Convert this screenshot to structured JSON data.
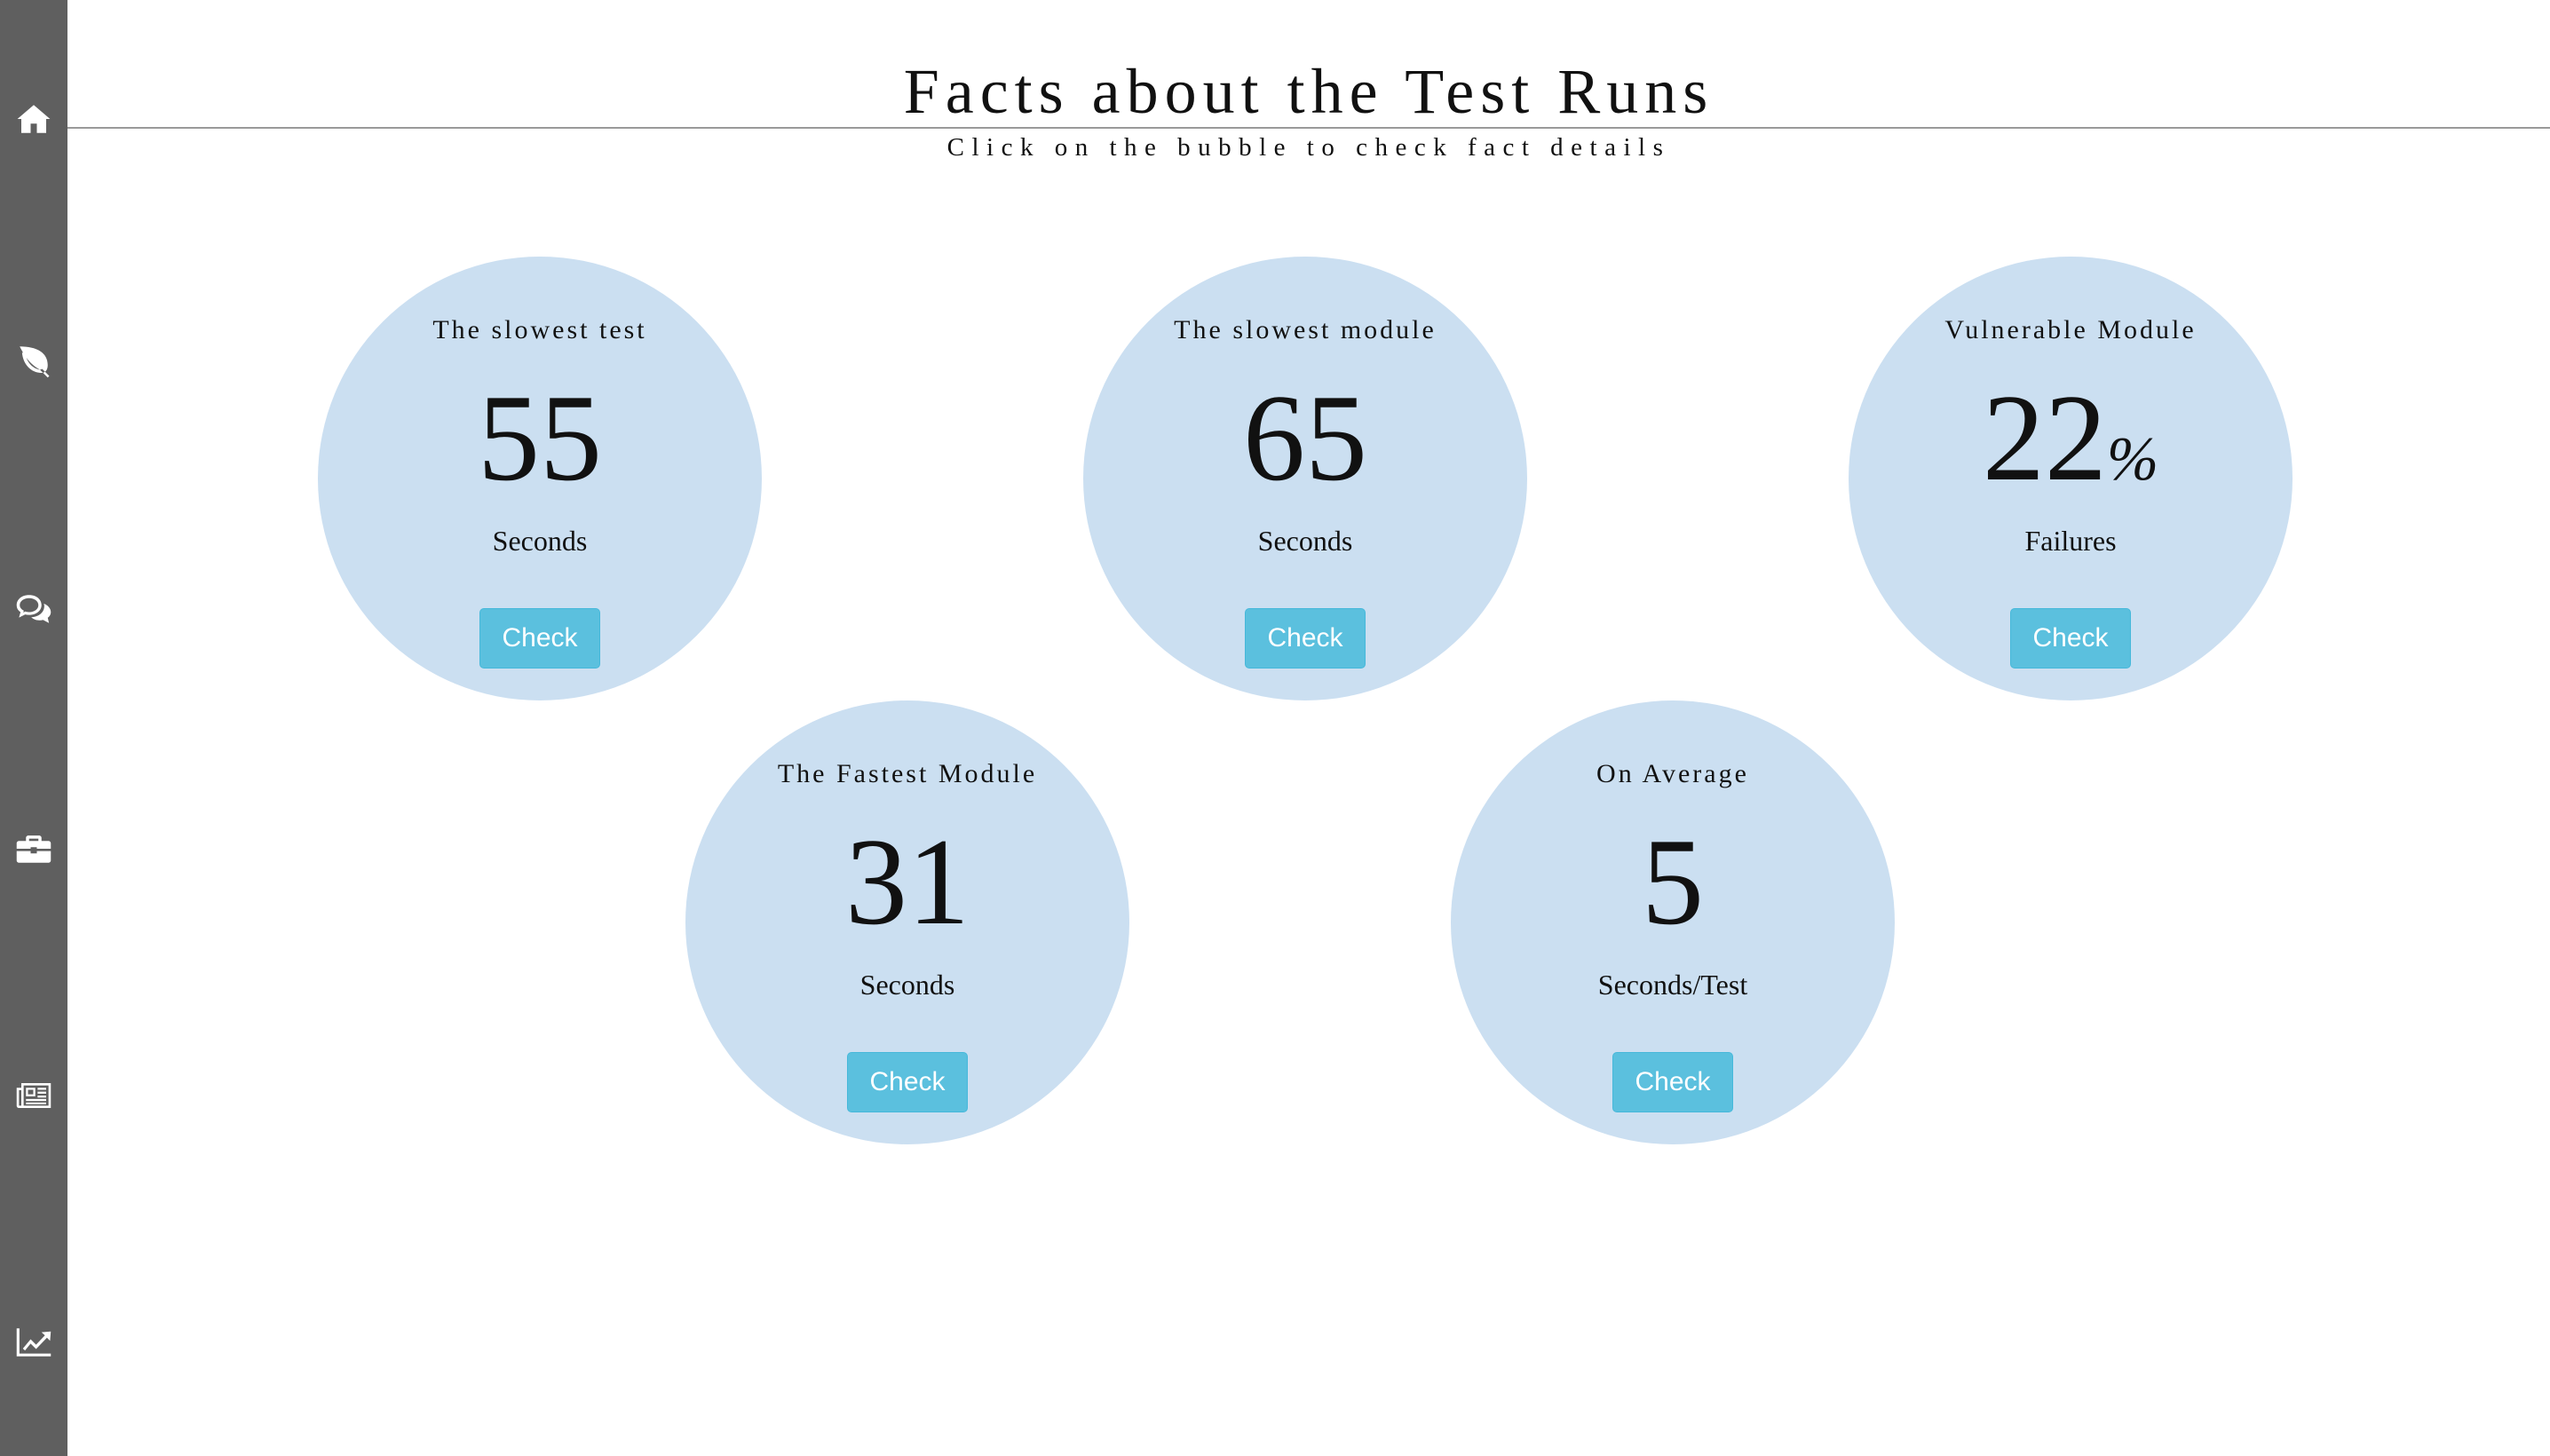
{
  "sidebar": {
    "items": [
      {
        "icon": "home-icon"
      },
      {
        "icon": "leaf-icon"
      },
      {
        "icon": "comments-icon"
      },
      {
        "icon": "briefcase-icon"
      },
      {
        "icon": "newspaper-icon"
      },
      {
        "icon": "line-chart-icon"
      }
    ]
  },
  "header": {
    "title": "Facts about the Test Runs",
    "subtitle": "Click on the bubble to check fact details"
  },
  "facts": [
    {
      "title": "The slowest test",
      "value": "55",
      "unit": "",
      "label": "Seconds",
      "button": "Check"
    },
    {
      "title": "The slowest module",
      "value": "65",
      "unit": "",
      "label": "Seconds",
      "button": "Check"
    },
    {
      "title": "Vulnerable Module",
      "value": "22",
      "unit": "%",
      "label": "Failures",
      "button": "Check"
    },
    {
      "title": "The Fastest Module",
      "value": "31",
      "unit": "",
      "label": "Seconds",
      "button": "Check"
    },
    {
      "title": "On Average",
      "value": "5",
      "unit": "",
      "label": "Seconds/Test",
      "button": "Check"
    }
  ],
  "colors": {
    "sidebar": "#5f5f5f",
    "bubble": "#cbdff1",
    "button": "#5bc0de"
  }
}
